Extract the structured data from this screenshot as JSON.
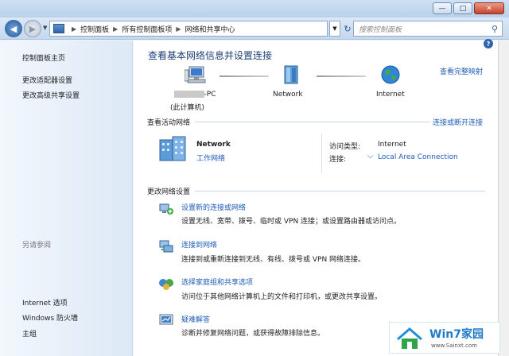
{
  "address": {
    "crumbs": [
      "控制面板",
      "所有控制面板项",
      "网络和共享中心"
    ],
    "search_placeholder": "搜索控制面板"
  },
  "sidebar": {
    "home": "控制面板主页",
    "items": [
      "更改适配器设置",
      "更改高级共享设置"
    ],
    "see_also_title": "另请参阅",
    "see_also": [
      "Internet 选项",
      "Windows 防火墙",
      "主组"
    ]
  },
  "main": {
    "title": "查看基本网络信息并设置连接",
    "full_map": "查看完整映射",
    "map": {
      "pc_suffix": "-PC",
      "pc_sub": "(此计算机)",
      "network": "Network",
      "internet": "Internet"
    },
    "active": {
      "heading": "查看活动网络",
      "connect_link": "连接或断开连接",
      "name": "Network",
      "type": "工作网络",
      "access_label": "访问类型:",
      "access_value": "Internet",
      "conn_label": "连接:",
      "conn_value": "Local Area Connection"
    },
    "change": {
      "heading": "更改网络设置",
      "tasks": [
        {
          "link": "设置新的连接或网络",
          "desc": "设置无线、宽带、拨号、临时或 VPN 连接；或设置路由器或访问点。"
        },
        {
          "link": "连接到网络",
          "desc": "连接到或重新连接到无线、有线、拨号或 VPN 网络连接。"
        },
        {
          "link": "选择家庭组和共享选项",
          "desc": "访问位于其他网络计算机上的文件和打印机，或更改共享设置。"
        },
        {
          "link": "疑难解答",
          "desc": "诊断并修复网络问题，或获得故障排除信息。"
        }
      ]
    }
  },
  "watermark": {
    "brand": "Win7家园",
    "url": "www.Sainxt.com"
  },
  "colors": {
    "link": "#1f5eb8",
    "title": "#1c3f78"
  }
}
